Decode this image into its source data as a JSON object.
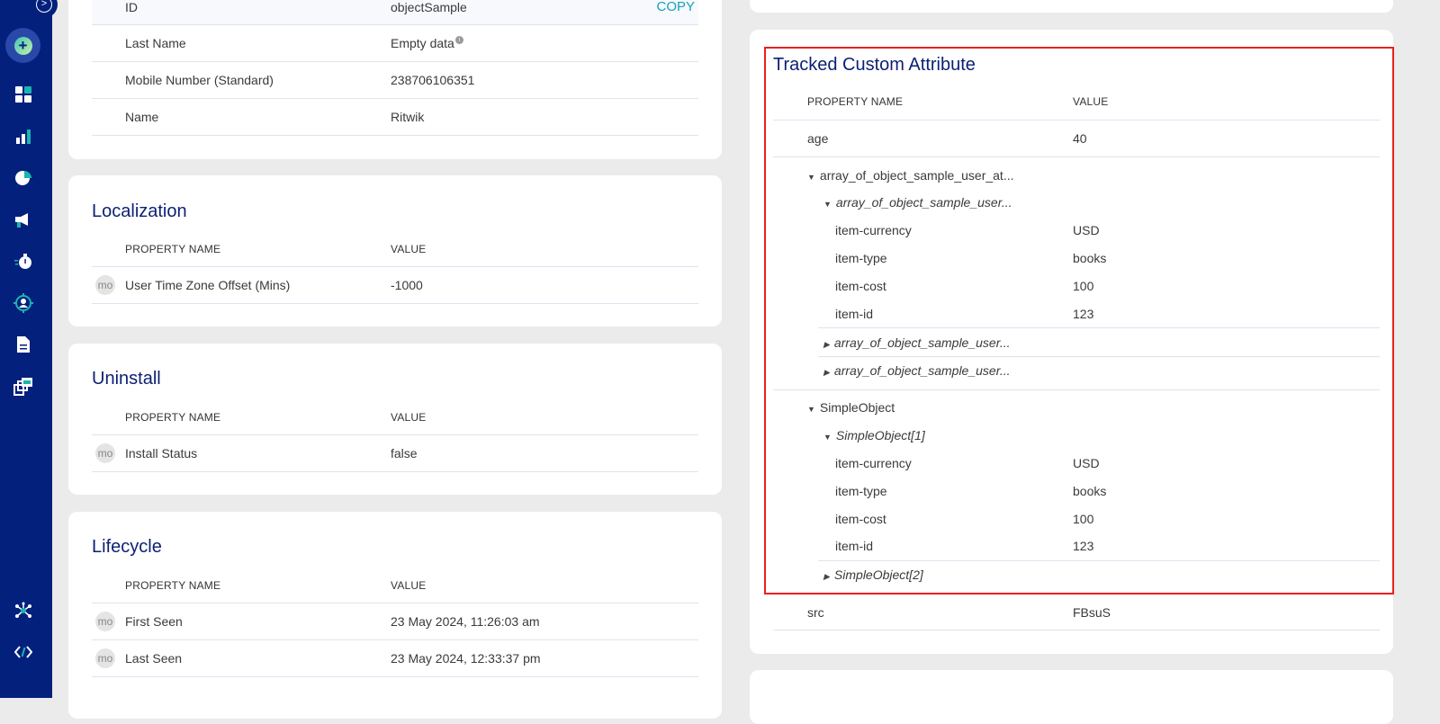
{
  "sidebar": {
    "items": [
      "create-icon",
      "dashboard-icon",
      "analytics-icon",
      "segments-icon",
      "campaigns-icon",
      "journeys-icon",
      "users-icon",
      "reports-icon",
      "templates-icon",
      "integrations-icon",
      "developer-icon"
    ]
  },
  "profile_card": {
    "rows": [
      {
        "label": "ID",
        "value": "objectSample",
        "action": "COPY"
      },
      {
        "label": "Last Name",
        "value": "Empty data"
      },
      {
        "label": "Mobile Number (Standard)",
        "value": "238706106351"
      },
      {
        "label": "Name",
        "value": "Ritwik"
      }
    ]
  },
  "headers": {
    "name": "PROPERTY NAME",
    "value": "VALUE"
  },
  "badge": "mo",
  "localization": {
    "title": "Localization",
    "rows": [
      {
        "label": "User Time Zone Offset (Mins)",
        "value": "-1000"
      }
    ]
  },
  "uninstall": {
    "title": "Uninstall",
    "rows": [
      {
        "label": "Install Status",
        "value": "false"
      }
    ]
  },
  "lifecycle": {
    "title": "Lifecycle",
    "rows": [
      {
        "label": "First Seen",
        "value": "23 May 2024, 11:26:03 am"
      },
      {
        "label": "Last Seen",
        "value": "23 May 2024, 12:33:37 pm"
      }
    ]
  },
  "tracked": {
    "title": "Tracked Custom Attribute",
    "age": {
      "label": "age",
      "value": "40"
    },
    "array": {
      "label": "array_of_object_sample_user_at...",
      "child": "array_of_object_sample_user...",
      "items": [
        {
          "k": "item-currency",
          "v": "USD"
        },
        {
          "k": "item-type",
          "v": "books"
        },
        {
          "k": "item-cost",
          "v": "100"
        },
        {
          "k": "item-id",
          "v": "123"
        }
      ],
      "collapsed": [
        "array_of_object_sample_user...",
        "array_of_object_sample_user..."
      ]
    },
    "simple": {
      "label": "SimpleObject",
      "child": "SimpleObject[1]",
      "items": [
        {
          "k": "item-currency",
          "v": "USD"
        },
        {
          "k": "item-type",
          "v": "books"
        },
        {
          "k": "item-cost",
          "v": "100"
        },
        {
          "k": "item-id",
          "v": "123"
        }
      ],
      "collapsed": [
        "SimpleObject[2]"
      ]
    },
    "src": {
      "label": "src",
      "value": "FBsuS"
    }
  }
}
